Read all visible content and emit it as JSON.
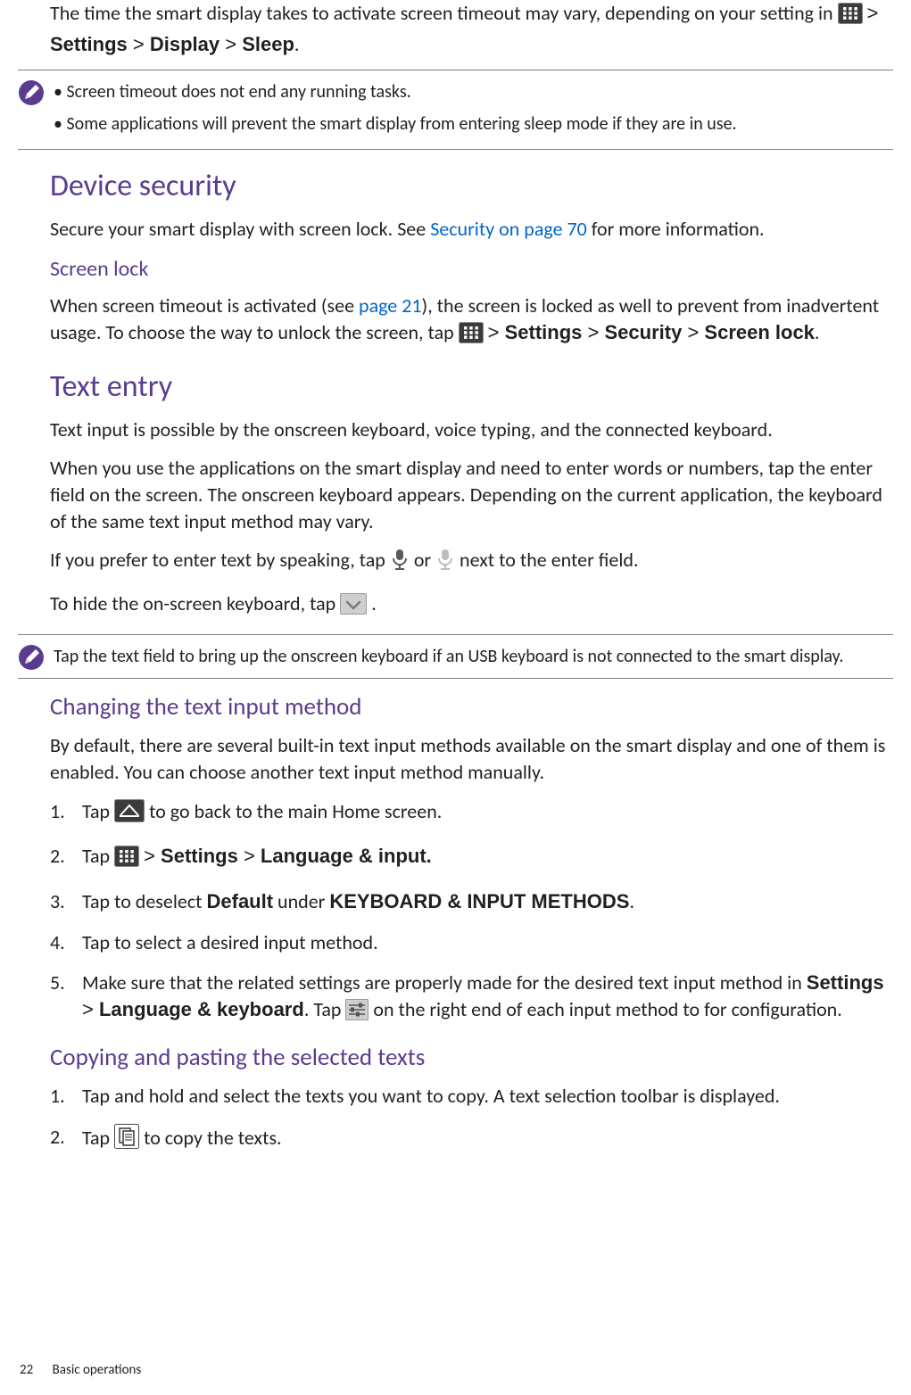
{
  "intro": {
    "sleep_sentence_a": "The time the smart display takes to activate screen timeout may vary, depending on your setting in ",
    "gt": " > ",
    "settings": "Settings",
    "display": "Display",
    "sleep": "Sleep",
    "period": "."
  },
  "note1": {
    "b1": "Screen timeout does not end any running tasks.",
    "b2": "Some applications will prevent the smart display from entering sleep mode if they are in use."
  },
  "device_security": {
    "heading": "Device security",
    "p1a": "Secure your smart display with screen lock. See ",
    "link": "Security on page 70",
    "p1b": " for more information."
  },
  "screen_lock": {
    "heading": "Screen lock",
    "p1a": "When screen timeout is activated (see ",
    "link": "page 21",
    "p1b": "), the screen is locked as well to prevent from inadvertent usage. To choose the way to unlock the screen, tap ",
    "settings": "Settings",
    "security": "Security",
    "screenlock": "Screen lock",
    "period": "."
  },
  "text_entry": {
    "heading": "Text entry",
    "p1": "Text input is possible by the onscreen keyboard, voice typing, and the connected keyboard.",
    "p2": "When you use the applications on the smart display and need to enter words or numbers, tap the enter field on the screen. The onscreen keyboard appears. Depending on the current application, the keyboard of the same text input method may vary.",
    "p3a": "If you prefer to enter text by speaking, tap ",
    "p3_or": " or ",
    "p3b": " next to the enter field.",
    "p4a": "To hide the on-screen keyboard, tap ",
    "p4b": "."
  },
  "note2": {
    "text": "Tap the text field to bring up the onscreen keyboard if an USB keyboard is not connected to the smart display."
  },
  "changing": {
    "heading": "Changing the text input method",
    "intro": "By default, there are several built-in text input methods available on the smart display and one of them is enabled. You can choose another text input method manually.",
    "s1a": "Tap ",
    "s1b": " to go back to the main Home screen.",
    "s2a": "Tap ",
    "s2_settings": "Settings",
    "s2_lang": "Language & input.",
    "s3a": "Tap to deselect ",
    "s3_default": "Default",
    "s3b": " under ",
    "s3_kim": "KEYBOARD & INPUT METHODS",
    "s3c": ".",
    "s4": "Tap to select a desired input method.",
    "s5a": "Make sure that the related settings are properly made for the desired text input method in ",
    "s5_settings": "Settings",
    "s5_lk": "Language & keyboard",
    "s5b": ". Tap ",
    "s5c": " on the right end of each input method to for configuration."
  },
  "copying": {
    "heading": "Copying and pasting the selected texts",
    "s1": "Tap and hold and select the texts you want to copy. A text selection toolbar is displayed.",
    "s2a": "Tap ",
    "s2b": " to copy the texts."
  },
  "footer": {
    "page": "22",
    "section": "Basic operations"
  }
}
